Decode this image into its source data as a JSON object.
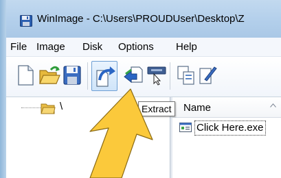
{
  "window": {
    "title": "WinImage - C:\\Users\\PROUDUser\\Desktop\\Z",
    "icon": "disk-icon"
  },
  "menubar": {
    "items": [
      "File",
      "Image",
      "Disk",
      "Options",
      "Help"
    ]
  },
  "toolbar": {
    "buttons": [
      {
        "name": "new-icon"
      },
      {
        "name": "open-folder-icon"
      },
      {
        "name": "save-icon"
      },
      {
        "name": "extract-icon",
        "hovered": true
      },
      {
        "name": "inject-icon"
      },
      {
        "name": "read-disk-icon"
      },
      {
        "name": "copy-icon"
      },
      {
        "name": "edit-icon"
      }
    ]
  },
  "tooltip": {
    "text": "Extract"
  },
  "tree": {
    "root_label": "\\"
  },
  "list": {
    "column_name": "Name",
    "files": [
      {
        "name": "Click Here.exe",
        "icon": "exe-file-icon"
      }
    ]
  },
  "annotation": {
    "arrow_color": "#fbc93b",
    "icon": "callout-arrow-icon"
  }
}
